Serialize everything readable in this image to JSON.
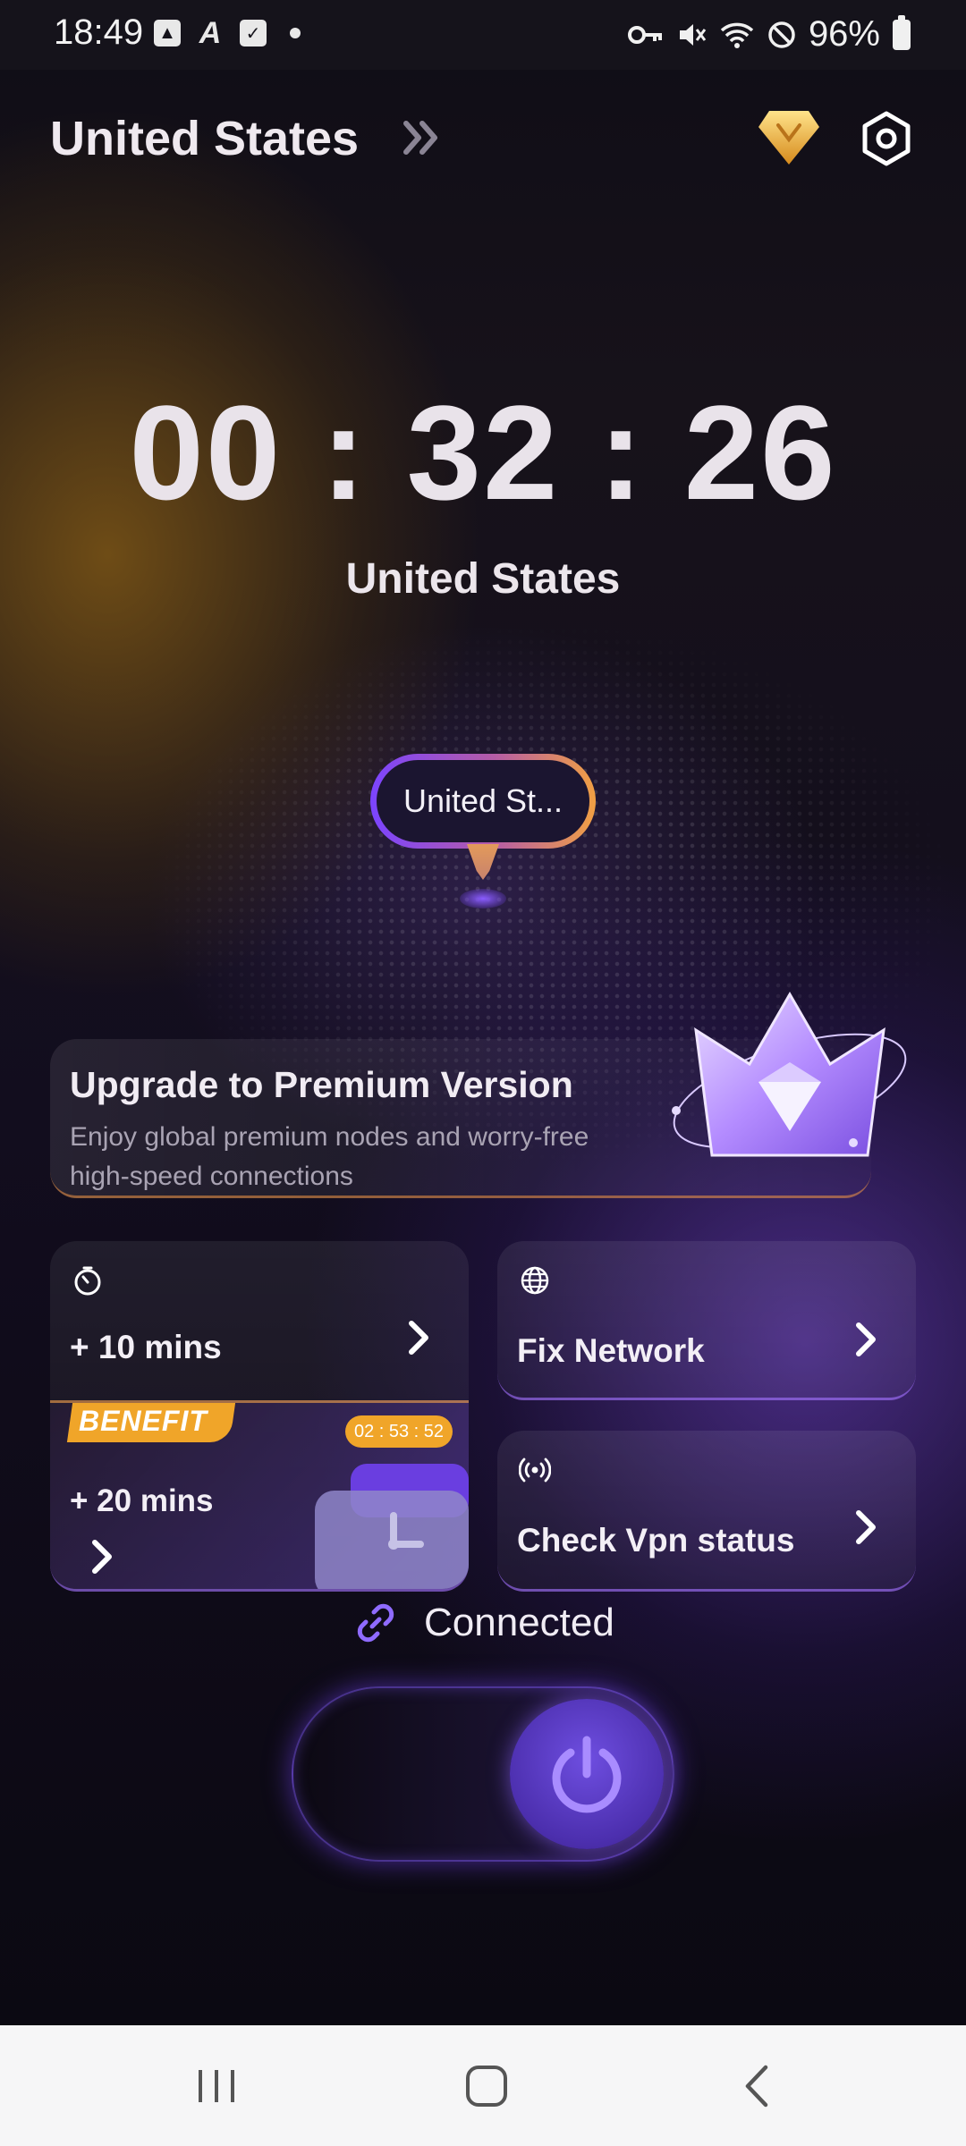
{
  "status_bar": {
    "time": "18:49",
    "battery": "96%",
    "left_icons": [
      "image-icon",
      "font-icon",
      "checkbox-icon",
      "dot-icon"
    ],
    "right_icons": [
      "vpn-key-icon",
      "mute-icon",
      "wifi-icon",
      "dnd-icon",
      "battery-icon"
    ]
  },
  "header": {
    "location": "United States",
    "chevron_icon": "double-chevron-right-icon",
    "premium_icon": "diamond-icon",
    "settings_icon": "gear-icon"
  },
  "session": {
    "timer": "00 : 32 : 26",
    "country": "United States",
    "pin_label": "United St..."
  },
  "upgrade": {
    "title": "Upgrade to Premium Version",
    "description": "Enjoy global premium nodes and worry-free high-speed connections",
    "art": "crown-diamond-icon"
  },
  "cards": {
    "add_time": {
      "label": "+ 10 mins",
      "icon": "timer-icon"
    },
    "benefit": {
      "badge": "BENEFIT",
      "countdown": "02 : 53 : 52",
      "label": "+ 20 mins",
      "art": "clock-icon"
    },
    "fix_network": {
      "label": "Fix Network",
      "icon": "globe-icon"
    },
    "check_vpn": {
      "label": "Check Vpn status",
      "icon": "broadcast-icon"
    }
  },
  "connection": {
    "status": "Connected",
    "status_icon": "link-icon",
    "toggle_state": "on",
    "toggle_icon": "power-icon"
  },
  "nav_bar": {
    "buttons": [
      "recent-apps-icon",
      "home-icon",
      "back-icon"
    ]
  },
  "colors": {
    "accent_purple": "#7b44ff",
    "accent_orange": "#f0a529",
    "background": "#0b0911"
  }
}
